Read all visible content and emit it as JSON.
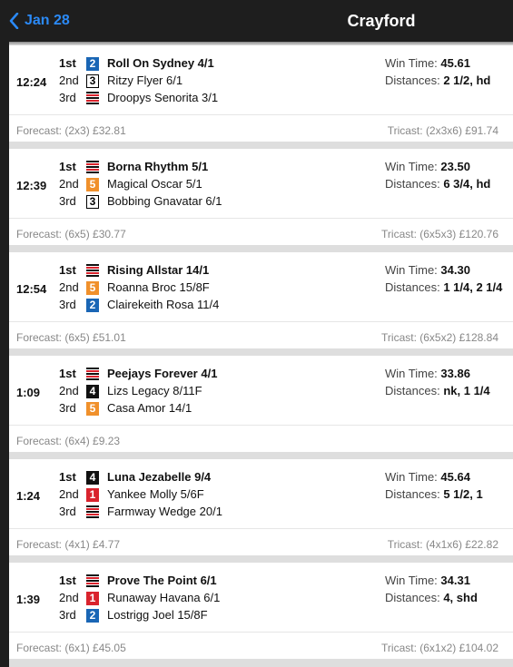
{
  "header": {
    "back_label": "Jan 28",
    "title": "Crayford"
  },
  "labels": {
    "win_time": "Win Time:",
    "distances": "Distances:",
    "forecast": "Forecast:",
    "tricast": "Tricast:"
  },
  "colors": {
    "accent": "#2b8af7",
    "header_bg": "#1e1e1e",
    "trap1": "#d9232d",
    "trap2": "#1a66b5",
    "trap5": "#f0902b"
  },
  "races": [
    {
      "time": "12:24",
      "win_time": "45.61",
      "distances": "2 1/2, hd",
      "forecast": "(2x3) £32.81",
      "tricast": "(2x3x6) £91.74",
      "results": [
        {
          "pos": "1st",
          "trap": "2",
          "dog": "Roll On Sydney 4/1"
        },
        {
          "pos": "2nd",
          "trap": "3",
          "dog": "Ritzy Flyer 6/1"
        },
        {
          "pos": "3rd",
          "trap": "6",
          "dog": "Droopys Senorita 3/1"
        }
      ]
    },
    {
      "time": "12:39",
      "win_time": "23.50",
      "distances": "6 3/4, hd",
      "forecast": "(6x5) £30.77",
      "tricast": "(6x5x3) £120.76",
      "results": [
        {
          "pos": "1st",
          "trap": "6",
          "dog": "Borna Rhythm 5/1"
        },
        {
          "pos": "2nd",
          "trap": "5",
          "dog": "Magical Oscar 5/1"
        },
        {
          "pos": "3rd",
          "trap": "3",
          "dog": "Bobbing Gnavatar 6/1"
        }
      ]
    },
    {
      "time": "12:54",
      "win_time": "34.30",
      "distances": "1 1/4, 2 1/4",
      "forecast": "(6x5) £51.01",
      "tricast": "(6x5x2) £128.84",
      "results": [
        {
          "pos": "1st",
          "trap": "6",
          "dog": "Rising Allstar 14/1"
        },
        {
          "pos": "2nd",
          "trap": "5",
          "dog": "Roanna Broc 15/8F"
        },
        {
          "pos": "3rd",
          "trap": "2",
          "dog": "Clairekeith Rosa 11/4"
        }
      ]
    },
    {
      "time": "1:09",
      "win_time": "33.86",
      "distances": "nk, 1 1/4",
      "forecast": "(6x4) £9.23",
      "tricast": "",
      "results": [
        {
          "pos": "1st",
          "trap": "6",
          "dog": "Peejays Forever 4/1"
        },
        {
          "pos": "2nd",
          "trap": "4",
          "dog": "Lizs Legacy 8/11F"
        },
        {
          "pos": "3rd",
          "trap": "5",
          "dog": "Casa Amor 14/1"
        }
      ]
    },
    {
      "time": "1:24",
      "win_time": "45.64",
      "distances": "5 1/2, 1",
      "forecast": "(4x1) £4.77",
      "tricast": "(4x1x6) £22.82",
      "results": [
        {
          "pos": "1st",
          "trap": "4",
          "dog": "Luna Jezabelle 9/4"
        },
        {
          "pos": "2nd",
          "trap": "1",
          "dog": "Yankee Molly 5/6F"
        },
        {
          "pos": "3rd",
          "trap": "6",
          "dog": "Farmway Wedge 20/1"
        }
      ]
    },
    {
      "time": "1:39",
      "win_time": "34.31",
      "distances": "4, shd",
      "forecast": "(6x1) £45.05",
      "tricast": "(6x1x2) £104.02",
      "results": [
        {
          "pos": "1st",
          "trap": "6",
          "dog": "Prove The Point 6/1"
        },
        {
          "pos": "2nd",
          "trap": "1",
          "dog": "Runaway Havana 6/1"
        },
        {
          "pos": "3rd",
          "trap": "2",
          "dog": "Lostrigg Joel 15/8F"
        }
      ]
    }
  ]
}
